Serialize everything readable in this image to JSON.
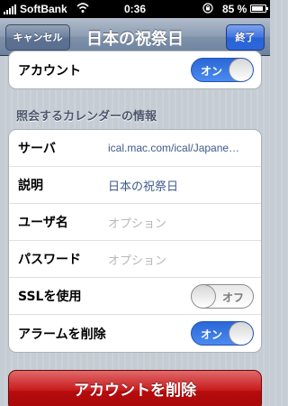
{
  "status_bar": {
    "carrier": "SoftBank",
    "time": "0:36",
    "battery_percent": "85 %",
    "battery_level": 0.85,
    "icons": [
      "signal-icon",
      "wifi-icon",
      "orientation-lock-icon",
      "battery-icon"
    ]
  },
  "nav": {
    "cancel_label": "キャンセル",
    "title": "日本の祝祭日",
    "done_label": "終了"
  },
  "account_row": {
    "label": "アカウント",
    "toggle_label": "オン",
    "toggle_on": true
  },
  "section": {
    "header": "照会するカレンダーの情報"
  },
  "fields": [
    {
      "label": "サーバ",
      "value": "ical.mac.com/ical/Japane…"
    },
    {
      "label": "説明",
      "value": "日本の祝祭日"
    },
    {
      "label": "ユーザ名",
      "placeholder": "オプション"
    },
    {
      "label": "パスワード",
      "placeholder": "オプション"
    }
  ],
  "ssl_row": {
    "label": "SSLを使用",
    "toggle_label": "オフ",
    "toggle_on": false
  },
  "alarm_row": {
    "label": "アラームを削除",
    "toggle_label": "オン",
    "toggle_on": true
  },
  "delete_button": {
    "label": "アカウントを削除"
  },
  "colors": {
    "accent_blue": "#2d66db",
    "nav_bar": "#7f91a9",
    "delete_red": "#c8191b",
    "value_text": "#3f5a8a",
    "section_header": "#4c566c"
  }
}
